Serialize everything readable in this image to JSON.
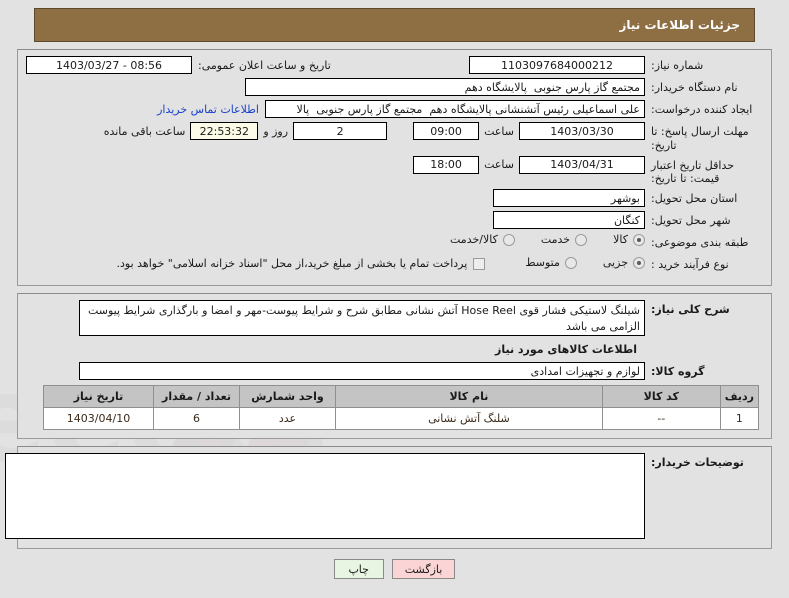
{
  "header": {
    "title": "جزئیات اطلاعات نیاز"
  },
  "info": {
    "need_number_label": "شماره نیاز:",
    "need_number_value": "1103097684000212",
    "announce_label": "تاریخ و ساعت اعلان عمومی:",
    "announce_value": "1403/03/27 - 08:56",
    "buyer_org_label": "نام دستگاه خریدار:",
    "buyer_org_value": "مجتمع گاز پارس جنوبی  پالایشگاه دهم",
    "requester_label": "ایجاد کننده درخواست:",
    "requester_value": "علی اسماعیلی رئیس آتشنشانی پالایشگاه دهم  مجتمع گاز پارس جنوبی  پالا",
    "contact_link": "اطلاعات تماس خریدار",
    "deadline_label": "مهلت ارسال پاسخ: تا تاریخ:",
    "deadline_date": "1403/03/30",
    "deadline_time_label": "ساعت",
    "deadline_time": "09:00",
    "days_value": "2",
    "days_label": "روز و",
    "timer_value": "22:53:32",
    "timer_label": "ساعت باقی مانده",
    "validity_label": "حداقل تاریخ اعتبار قیمت: تا تاریخ:",
    "validity_date": "1403/04/31",
    "validity_time_label": "ساعت",
    "validity_time": "18:00",
    "province_label": "استان محل تحویل:",
    "province_value": "بوشهر",
    "city_label": "شهر محل تحویل:",
    "city_value": "کنگان",
    "category_label": "طبقه بندی موضوعی:",
    "category_options": [
      {
        "label": "کالا",
        "selected": true
      },
      {
        "label": "خدمت",
        "selected": false
      },
      {
        "label": "کالا/خدمت",
        "selected": false
      }
    ],
    "process_label": "نوع فرآیند خرید :",
    "process_options": [
      {
        "label": "جزیی",
        "selected": true
      },
      {
        "label": "متوسط",
        "selected": false
      }
    ],
    "treasury_checkbox_label": "پرداخت تمام یا بخشی از مبلغ خرید،از محل \"اسناد خزانه اسلامی\" خواهد بود.",
    "treasury_checked": false
  },
  "description": {
    "label": "شرح کلی نیاز:",
    "value": "شیلنگ لاستیکی فشار قوی Hose Reel آتش نشانی مطابق شرح و شرایط پیوست-مهر و امضا و بارگذاری شرایط پیوست الزامی می باشد"
  },
  "goods": {
    "section_title": "اطلاعات کالاهای مورد نیاز",
    "group_label": "گروه کالا:",
    "group_value": "لوازم و تجهیزات امدادی",
    "columns": [
      "ردیف",
      "کد کالا",
      "نام کالا",
      "واحد شمارش",
      "تعداد / مقدار",
      "تاریخ نیاز"
    ],
    "rows": [
      {
        "index": "1",
        "code": "--",
        "name": "شلنگ آتش نشانی",
        "unit": "عدد",
        "qty": "6",
        "need_date": "1403/04/10"
      }
    ]
  },
  "notes": {
    "label": "توضیحات خریدار:",
    "value": ""
  },
  "footer": {
    "back_label": "بازگشت",
    "print_label": "چاپ"
  },
  "colors": {
    "header_bg": "#8d6f43",
    "panel_bg": "#e2e2e2",
    "link": "#1a44c8",
    "timer_bg": "#fbfbe8",
    "table_header_bg": "#c4c4c4",
    "btn_back_bg": "#fbd5d5",
    "btn_print_bg": "#e8f5e2"
  }
}
